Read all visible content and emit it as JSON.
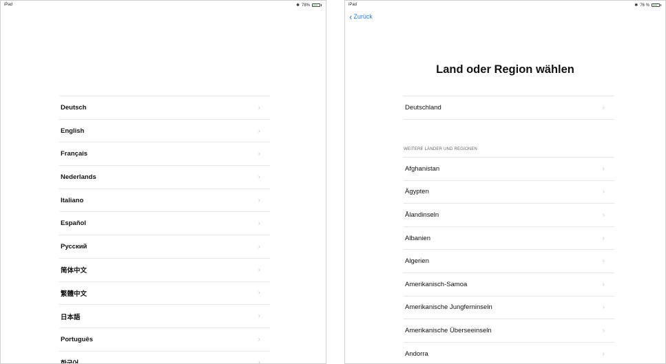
{
  "left_screen": {
    "status": {
      "device": "iPad",
      "battery": "78%",
      "battery_level": 0.78
    },
    "languages": [
      "Deutsch",
      "English",
      "Français",
      "Nederlands",
      "Italiano",
      "Español",
      "Русский",
      "简体中文",
      "繁體中文",
      "日本語",
      "Português",
      "한국어"
    ]
  },
  "right_screen": {
    "status": {
      "device": "iPad",
      "battery": "76 %",
      "battery_level": 0.76
    },
    "back_label": "Zurück",
    "title": "Land oder Region wählen",
    "home_country": "Deutschland",
    "section_header": "WEITERE LÄNDER UND REGIONEN",
    "countries": [
      "Afghanistan",
      "Ägypten",
      "Ålandinseln",
      "Albanien",
      "Algerien",
      "Amerikanisch-Samoa",
      "Amerikanische Jungferninseln",
      "Amerikanische Überseeinseln",
      "Andorra"
    ]
  },
  "icons": {
    "chevron": "›",
    "back": "‹",
    "bluetooth": "bluetooth-icon",
    "battery": "battery-icon"
  },
  "colors": {
    "accent": "#1e7cf2",
    "battery": "#4cd964",
    "separator": "#e6e6e6",
    "chevron": "#c7c7cc"
  }
}
